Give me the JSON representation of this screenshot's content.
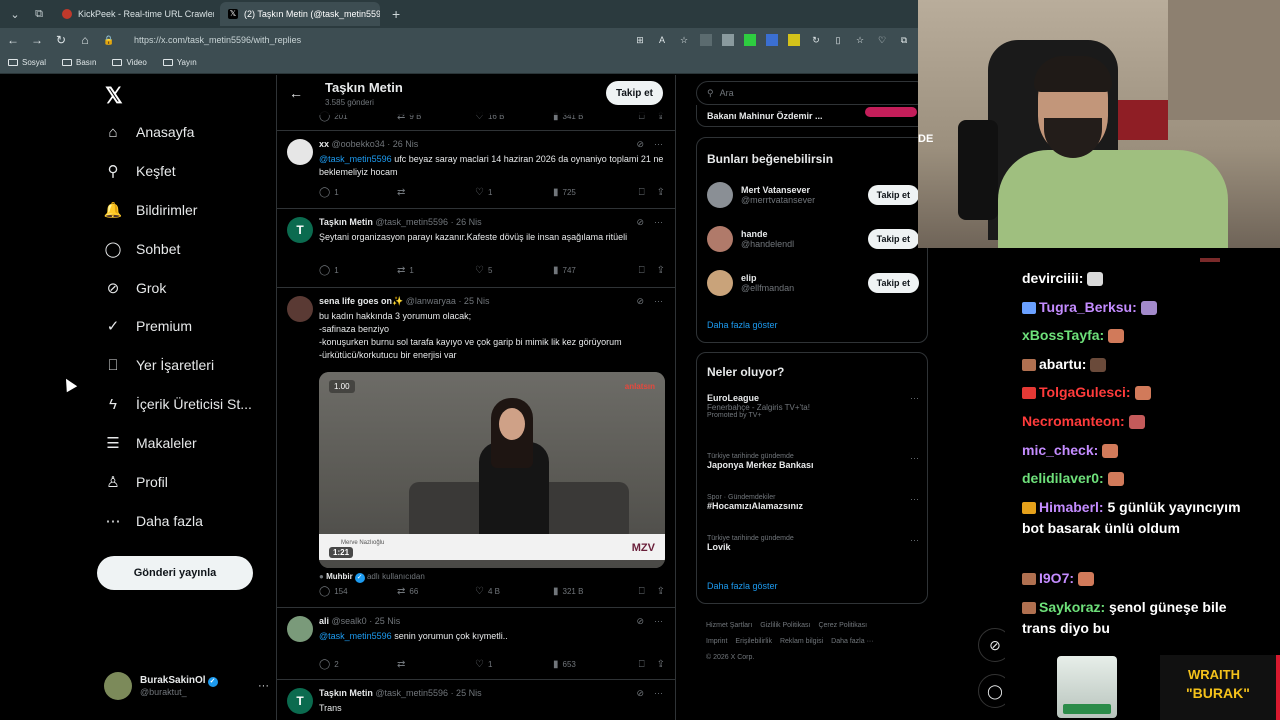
{
  "browser": {
    "tabs": [
      {
        "title": "KickPeek - Real-time URL Crawler",
        "close": "✕",
        "color": "#c0392b"
      },
      {
        "title": "(2) Taşkın Metin (@task_metin5596",
        "close": "✕",
        "color": "#000000"
      }
    ],
    "new_tab": "+",
    "url": "https://x.com/task_metin5596/with_replies",
    "bookmarks": [
      "Sosyal",
      "Basın",
      "Video",
      "Yayın"
    ]
  },
  "nav": {
    "items": [
      {
        "label": "Anasayfa",
        "icon": "home-icon",
        "glyph": "⌂"
      },
      {
        "label": "Keşfet",
        "icon": "search-icon",
        "glyph": "⚲"
      },
      {
        "label": "Bildirimler",
        "icon": "bell-icon",
        "glyph": "🔔",
        "badge": "2"
      },
      {
        "label": "Sohbet",
        "icon": "chat-icon",
        "glyph": "◯"
      },
      {
        "label": "Grok",
        "icon": "grok-icon",
        "glyph": "⊘"
      },
      {
        "label": "Premium",
        "icon": "premium-icon",
        "glyph": "✓"
      },
      {
        "label": "Yer İşaretleri",
        "icon": "bookmark-icon",
        "glyph": "⎕"
      },
      {
        "label": "İçerik Üreticisi St...",
        "icon": "lightning-icon",
        "glyph": "ϟ"
      },
      {
        "label": "Makaleler",
        "icon": "article-icon",
        "glyph": "☰"
      },
      {
        "label": "Profil",
        "icon": "profile-icon",
        "glyph": "♙"
      },
      {
        "label": "Daha fazla",
        "icon": "more-icon",
        "glyph": "⋯"
      }
    ],
    "post_button": "Gönderi yayınla",
    "account": {
      "name": "BurakSakinOl",
      "handle": "@buraktut_",
      "more": "···"
    }
  },
  "profile_header": {
    "name": "Taşkın Metin",
    "posts": "3.585 gönderi",
    "follow": "Takip et"
  },
  "top_actions": {
    "replies": "201",
    "reposts": "9 B",
    "likes": "16 B",
    "views": "341 B"
  },
  "tweets": [
    {
      "name": "xx",
      "handle": "@oobekko34",
      "date": "· 26 Nis",
      "mention": "@task_metin5596",
      "text": " ufc beyaz saray maclari 14 haziran 2026 da oynaniyo toplami 21 ne beklemeliyiz hocam",
      "replies": "1",
      "reposts": "",
      "likes": "1",
      "views": "725"
    },
    {
      "name": "Taşkın Metin",
      "handle": "@task_metin5596",
      "date": "· 26 Nis",
      "mention": "",
      "text": "Şeytani organizasyon parayı kazanır.Kafeste dövüş ile insan aşağılama ritüeli",
      "replies": "1",
      "reposts": "1",
      "likes": "5",
      "views": "747"
    },
    {
      "name": "sena life goes on✨",
      "handle": "@lanwaryaa",
      "date": "· 25 Nis",
      "mention": "",
      "text": "bu kadın hakkında 3 yorumum olacak;\n-safinaza benziyo\n-konuşurken burnu sol tarafa kayıyo ve çok garip bi mimik lik kez görüyorum\n-ürkütücü/korkutucu bir enerjisi var",
      "replies": "154",
      "reposts": "66",
      "likes": "4 B",
      "views": "321 B",
      "media": {
        "speed": "1.00",
        "duration": "1:21",
        "brand": "anlatsın",
        "logo": "MZV",
        "lower_name": "Merve Nazlıoğlu"
      },
      "source_name": "Muhbir",
      "source_suffix": " adlı kullanıcıdan"
    },
    {
      "name": "ali",
      "handle": "@sealk0",
      "date": "· 25 Nis",
      "mention": "@task_metin5596",
      "text": " senin yorumun çok kıymetli..",
      "replies": "2",
      "reposts": "",
      "likes": "1",
      "views": "653"
    },
    {
      "name": "Taşkın Metin",
      "handle": "@task_metin5596",
      "date": "· 25 Nis",
      "mention": "",
      "text": "Trans"
    }
  ],
  "right": {
    "search_placeholder": "Ara",
    "partial_item": "Bakanı Mahinur Özdemir ...",
    "wtf_title": "Bunları beğenebilirsin",
    "wtf": [
      {
        "name": "Mert Vatansever",
        "handle": "@merrtvatansever",
        "follow": "Takip et"
      },
      {
        "name": "hande",
        "handle": "@handelendl",
        "follow": "Takip et"
      },
      {
        "name": "elip",
        "handle": "@ellfmandan",
        "follow": "Takip et"
      }
    ],
    "show_more": "Daha fazla göster",
    "trends_title": "Neler oluyor?",
    "trends": [
      {
        "context": "",
        "title": "EuroLeague",
        "sub": "Fenerbahçe - Zalgiris TV+'ta!",
        "promo": "Promoted by TV+"
      },
      {
        "context": "Türkiye tarihinde gündemde",
        "title": "Japonya Merkez Bankası",
        "sub": "",
        "promo": ""
      },
      {
        "context": "Spor · Gündemdekiler",
        "title": "#HocamızıAlamazsınız",
        "sub": "",
        "promo": ""
      },
      {
        "context": "Türkiye tarihinde gündemde",
        "title": "Lovik",
        "sub": "",
        "promo": ""
      }
    ],
    "show_more2": "Daha fazla göster",
    "footer": [
      "Hizmet Şartları",
      "Gizlilik Politikası",
      "Çerez Politikası",
      "Imprint",
      "Erişilebilirlik",
      "Reklam bilgisi",
      "Daha fazla ···",
      "© 2026 X Corp."
    ]
  },
  "stream": {
    "cam_text": "DE",
    "chat": [
      {
        "user": "devirciiii:",
        "text": "",
        "color": "#ffffff"
      },
      {
        "user": "Tugra_Berksu:",
        "text": "",
        "color": "#c48cff"
      },
      {
        "user": "xBossTayfa:",
        "text": "",
        "color": "#6ee07a"
      },
      {
        "user": "abartu:",
        "text": "",
        "color": "#ffffff"
      },
      {
        "user": "TolgaGulesci:",
        "text": "",
        "color": "#ff3b3b"
      },
      {
        "user": "Necromanteon:",
        "text": "",
        "color": "#ff3b3b"
      },
      {
        "user": "mic_check:",
        "text": "",
        "color": "#c48cff"
      },
      {
        "user": "delidilaver0:",
        "text": "",
        "color": "#6ee07a"
      },
      {
        "user": "Himaberl:",
        "text": " 5 günlük yayıncıyım bot basarak ünlü oldum",
        "color": "#c48cff"
      },
      {
        "user": "I9O7:",
        "text": "",
        "color": "#c48cff"
      },
      {
        "user": "Saykoraz:",
        "text": " şenol güneşe bile trans diyo bu",
        "color": "#6ee07a"
      }
    ],
    "overlay_line1": "WRAITH",
    "overlay_line2": "\"BURAK\""
  }
}
